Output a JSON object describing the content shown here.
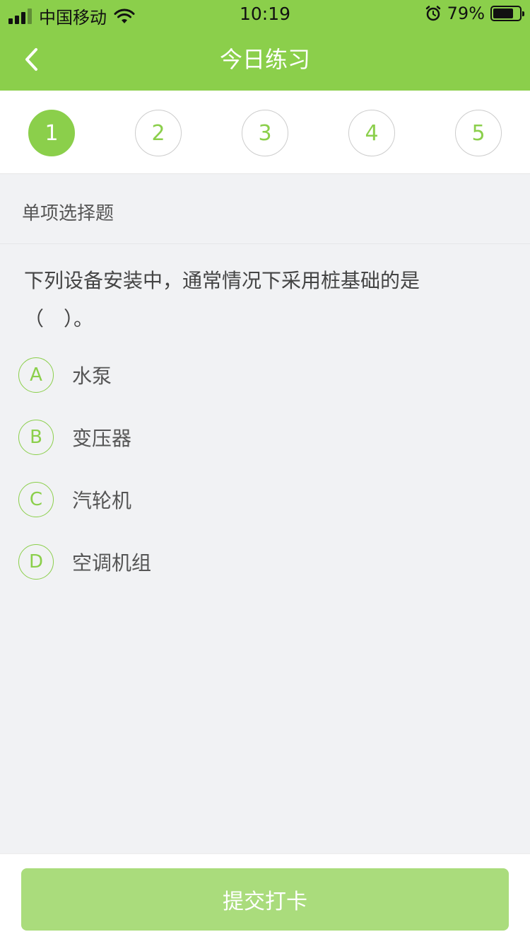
{
  "status_bar": {
    "carrier": "中国移动",
    "time": "10:19",
    "battery_percent": "79%",
    "battery_level": 0.79
  },
  "nav": {
    "title": "今日练习",
    "back_icon": "chevron-left-icon"
  },
  "steps": [
    {
      "label": "1",
      "active": true
    },
    {
      "label": "2",
      "active": false
    },
    {
      "label": "3",
      "active": false
    },
    {
      "label": "4",
      "active": false
    },
    {
      "label": "5",
      "active": false
    }
  ],
  "section": {
    "type_label": "单项选择题"
  },
  "question": {
    "text_line1": "下列设备安装中，通常情况下采用桩基础的是",
    "text_line2": "（　）。"
  },
  "options": [
    {
      "letter": "A",
      "text": "水泵"
    },
    {
      "letter": "B",
      "text": "变压器"
    },
    {
      "letter": "C",
      "text": "汽轮机"
    },
    {
      "letter": "D",
      "text": "空调机组"
    }
  ],
  "footer": {
    "submit_label": "提交打卡"
  },
  "colors": {
    "accent": "#8bcf4b",
    "submit_disabled": "#aadc7c",
    "background": "#f1f2f4"
  }
}
